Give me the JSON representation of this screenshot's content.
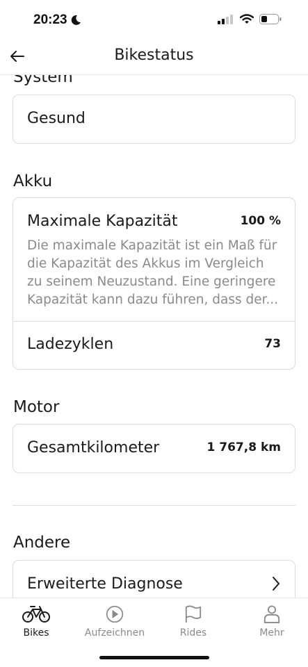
{
  "status_bar": {
    "time": "20:23"
  },
  "header": {
    "title": "Bikestatus"
  },
  "sections": {
    "system": {
      "title": "System",
      "status": "Gesund"
    },
    "akku": {
      "title": "Akku",
      "capacity_label": "Maximale Kapazität",
      "capacity_value": "100 %",
      "capacity_description": "Die maximale Kapazität ist ein Maß für die Kapazität des Akkus im Vergleich zu seinem Neuzustand. Eine geringere Kapazität kann dazu führen, dass der...",
      "cycles_label": "Ladezyklen",
      "cycles_value": "73"
    },
    "motor": {
      "title": "Motor",
      "km_label": "Gesamtkilometer",
      "km_value": "1 767,8 km"
    },
    "andere": {
      "title": "Andere",
      "diagnose_label": "Erweiterte Diagnose"
    }
  },
  "tabbar": {
    "tabs": [
      {
        "label": "Bikes",
        "icon": "bike-icon",
        "active": true
      },
      {
        "label": "Aufzeichnen",
        "icon": "play-icon",
        "active": false
      },
      {
        "label": "Rides",
        "icon": "flag-icon",
        "active": false
      },
      {
        "label": "Mehr",
        "icon": "person-icon",
        "active": false
      }
    ]
  }
}
